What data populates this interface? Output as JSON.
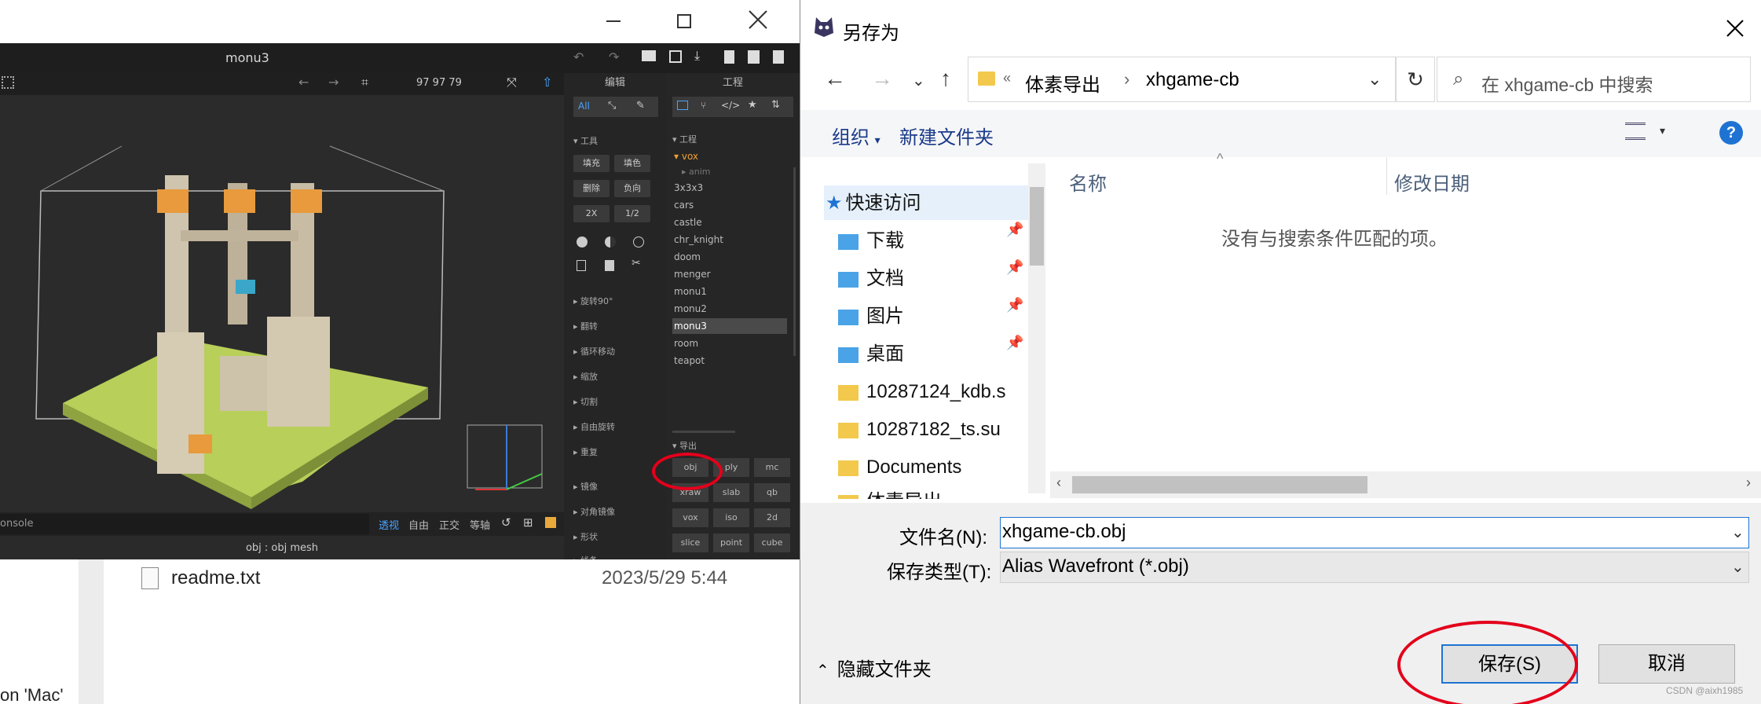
{
  "background_explorer": {
    "file_name": "readme.txt",
    "file_date": "2023/5/29 5:44",
    "side_text": "on 'Mac'"
  },
  "magicavoxel": {
    "window_title": "monu3",
    "dims": "97  97  79",
    "edit_title": "编辑",
    "project_title": "工程",
    "edit_modes": [
      "All"
    ],
    "tools_group": "工具",
    "tool_buttons": [
      "填充",
      "填色",
      "删除",
      "负向",
      "2X",
      "1/2"
    ],
    "edit_sections": [
      "旋转90°",
      "翻转",
      "循环移动",
      "缩放",
      "切割",
      "自由旋转",
      "重复",
      "镜像",
      "对角镜像",
      "形状",
      "线条"
    ],
    "project_group": "工程",
    "vox_folder": "vox",
    "anim_folder": "anim",
    "projects": [
      "3x3x3",
      "cars",
      "castle",
      "chr_knight",
      "doom",
      "menger",
      "monu1",
      "monu2",
      "monu3",
      "room",
      "teapot"
    ],
    "selected_project": "monu3",
    "export_group": "导出",
    "export_buttons": [
      "obj",
      "ply",
      "mc",
      "xraw",
      "slab",
      "qb",
      "vox",
      "iso",
      "2d",
      "slice",
      "point",
      "cube"
    ],
    "console_placeholder": "onsole",
    "view_modes": [
      "透视",
      "自由",
      "正交",
      "等轴"
    ],
    "status_text": "obj : obj mesh"
  },
  "dialog": {
    "title": "另存为",
    "breadcrumb_sep": "«",
    "breadcrumb": [
      "体素导出",
      "xhgame-cb"
    ],
    "search_placeholder": "在 xhgame-cb 中搜索",
    "organize": "组织",
    "new_folder": "新建文件夹",
    "nav_items": [
      {
        "label": "快速访问",
        "icon": "star-icon",
        "pinned": false
      },
      {
        "label": "下载",
        "icon": "download-folder-icon",
        "pinned": true
      },
      {
        "label": "文档",
        "icon": "documents-folder-icon",
        "pinned": true
      },
      {
        "label": "图片",
        "icon": "pictures-folder-icon",
        "pinned": true
      },
      {
        "label": "桌面",
        "icon": "desktop-folder-icon",
        "pinned": true
      },
      {
        "label": "10287124_kdb.s",
        "icon": "folder-icon",
        "pinned": false
      },
      {
        "label": "10287182_ts.su",
        "icon": "folder-icon",
        "pinned": false
      },
      {
        "label": "Documents",
        "icon": "folder-icon",
        "pinned": false
      },
      {
        "label": "体素导出",
        "icon": "folder-icon",
        "pinned": false
      }
    ],
    "col_name": "名称",
    "col_date": "修改日期",
    "empty_message": "没有与搜索条件匹配的项。",
    "filename_label": "文件名(N):",
    "filename_value": "xhgame-cb.obj",
    "filetype_label": "保存类型(T):",
    "filetype_value": "Alias Wavefront (*.obj)",
    "hide_folders": "隐藏文件夹",
    "save_button": "保存(S)",
    "cancel_button": "取消",
    "watermark": "CSDN @aixh1985"
  },
  "colors": {
    "annotation_red": "#e3001b",
    "accent_blue": "#0078d7",
    "magica_bg": "#2b2b2b",
    "voxel_green": "#b8cf5a"
  }
}
